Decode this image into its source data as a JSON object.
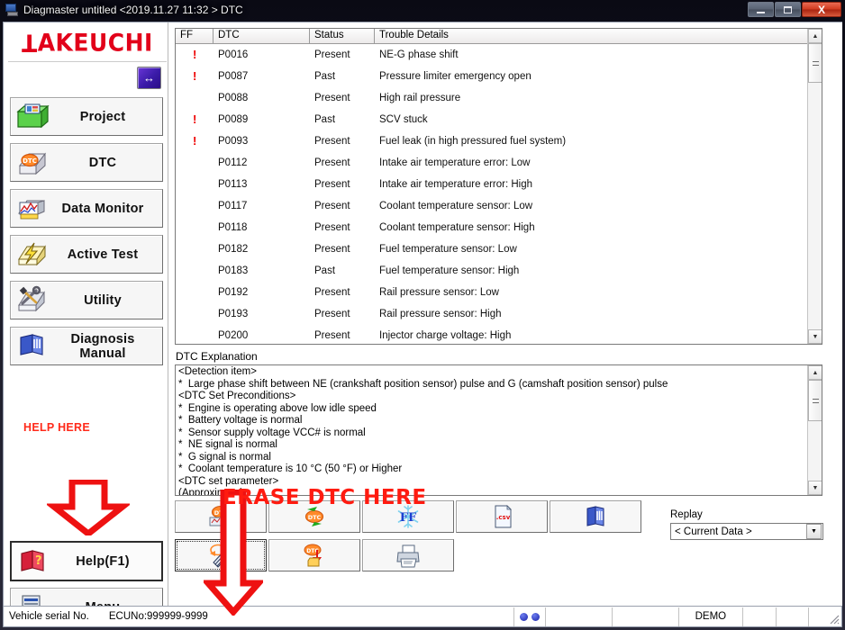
{
  "window": {
    "title": "Diagmaster untitled <2019.11.27 11:32 > DTC",
    "icon": "app-monitor-icon",
    "minimize_label": "–",
    "maximize_label": "□",
    "close_label": "X"
  },
  "sidebar": {
    "logo": "TAKEUCHI",
    "expand_button": "↔",
    "items": [
      {
        "label": "Project",
        "icon": "project-folder-icon"
      },
      {
        "label": "DTC",
        "icon": "dtc-icon"
      },
      {
        "label": "Data Monitor",
        "icon": "data-monitor-icon"
      },
      {
        "label": "Active Test",
        "icon": "active-test-icon"
      },
      {
        "label": "Utility",
        "icon": "utility-tools-icon"
      },
      {
        "label": "Diagnosis Manual",
        "icon": "manual-book-icon"
      }
    ],
    "help_here": "HELP HERE",
    "help_button": {
      "label": "Help(F1)",
      "icon": "help-book-icon"
    },
    "menu_button": {
      "label": "Menu",
      "icon": "menu-server-icon"
    }
  },
  "table": {
    "columns": [
      "FF",
      "DTC",
      "Status",
      "Trouble Details"
    ],
    "rows": [
      {
        "ff": "!",
        "dtc": "P0016",
        "status": "Present",
        "details": "NE-G phase shift"
      },
      {
        "ff": "!",
        "dtc": "P0087",
        "status": "Past",
        "details": "Pressure limiter emergency open"
      },
      {
        "ff": "",
        "dtc": "P0088",
        "status": "Present",
        "details": "High rail pressure"
      },
      {
        "ff": "!",
        "dtc": "P0089",
        "status": "Past",
        "details": "SCV stuck"
      },
      {
        "ff": "!",
        "dtc": "P0093",
        "status": "Present",
        "details": "Fuel leak (in high pressured fuel system)"
      },
      {
        "ff": "",
        "dtc": "P0112",
        "status": "Present",
        "details": "Intake air temperature error: Low"
      },
      {
        "ff": "",
        "dtc": "P0113",
        "status": "Present",
        "details": "Intake air temperature error: High"
      },
      {
        "ff": "",
        "dtc": "P0117",
        "status": "Present",
        "details": "Coolant temperature sensor: Low"
      },
      {
        "ff": "",
        "dtc": "P0118",
        "status": "Present",
        "details": "Coolant temperature sensor: High"
      },
      {
        "ff": "",
        "dtc": "P0182",
        "status": "Present",
        "details": "Fuel temperature sensor: Low"
      },
      {
        "ff": "",
        "dtc": "P0183",
        "status": "Past",
        "details": "Fuel temperature sensor: High"
      },
      {
        "ff": "",
        "dtc": "P0192",
        "status": "Present",
        "details": "Rail pressure sensor: Low"
      },
      {
        "ff": "",
        "dtc": "P0193",
        "status": "Present",
        "details": "Rail pressure sensor: High"
      },
      {
        "ff": "",
        "dtc": "P0200",
        "status": "Present",
        "details": "Injector charge voltage: High"
      }
    ]
  },
  "explanation": {
    "label": "DTC Explanation",
    "text": "<Detection item>\n*  Large phase shift between NE (crankshaft position sensor) pulse and G (camshaft position sensor) pulse\n<DTC Set Preconditions>\n*  Engine is operating above low idle speed\n*  Battery voltage is normal\n*  Sensor supply voltage VCC# is normal\n*  NE signal is normal\n*  G signal is normal\n*  Coolant temperature is 10 °C (50 °F) or Higher\n<DTC set parameter>\n(Approximate)"
  },
  "toolbar": {
    "row1": [
      {
        "name": "read-dtc-button",
        "icon": "dtc-read-icon"
      },
      {
        "name": "refresh-dtc-button",
        "icon": "dtc-refresh-icon"
      },
      {
        "name": "freeze-frame-button",
        "icon": "ff-snowflake-icon"
      },
      {
        "name": "export-csv-button",
        "icon": "csv-file-icon"
      },
      {
        "name": "diagnosis-manual-button",
        "icon": "manual-book-icon"
      }
    ],
    "row2": [
      {
        "name": "erase-dtc-button",
        "icon": "erase-dtc-icon"
      },
      {
        "name": "save-dtc-button",
        "icon": "dtc-save-folder-icon"
      },
      {
        "name": "print-button",
        "icon": "printer-icon"
      }
    ]
  },
  "replay": {
    "label": "Replay",
    "value": "< Current Data >",
    "dropdown_glyph": "▼"
  },
  "statusbar": {
    "vehicle_serial_label": "Vehicle serial No.",
    "ecu_no": "ECUNo:999999-9999",
    "demo": "DEMO"
  },
  "annotation": {
    "erase_text": "ERASE DTC HERE",
    "color": "#ff1b10"
  }
}
